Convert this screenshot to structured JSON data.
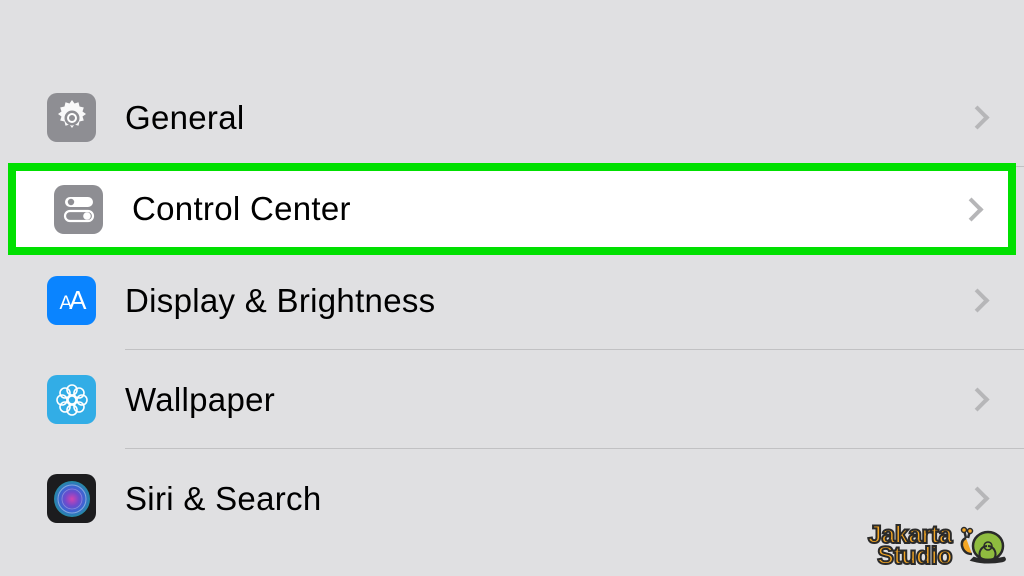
{
  "settings": {
    "rows": [
      {
        "label": "General",
        "icon": "gear"
      },
      {
        "label": "Control Center",
        "icon": "control-center",
        "highlighted": true
      },
      {
        "label": "Display & Brightness",
        "icon": "display"
      },
      {
        "label": "Wallpaper",
        "icon": "wallpaper"
      },
      {
        "label": "Siri & Search",
        "icon": "siri"
      }
    ]
  },
  "watermark": {
    "line1": "Jakarta",
    "line2": "Studio"
  }
}
